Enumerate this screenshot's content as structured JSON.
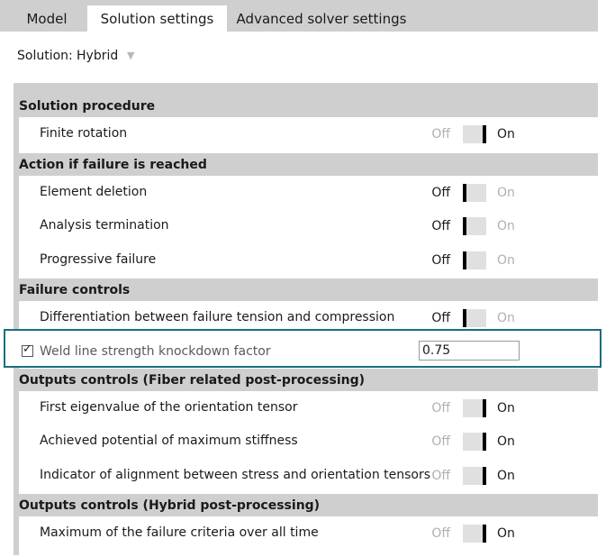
{
  "tabs": [
    {
      "label": "Model",
      "active": false
    },
    {
      "label": "Solution settings",
      "active": true
    },
    {
      "label": "Advanced solver settings",
      "active": false
    }
  ],
  "solution": {
    "label": "Solution:",
    "value": "Hybrid"
  },
  "toggle_text": {
    "off": "Off",
    "on": "On"
  },
  "sections": [
    {
      "title": "Solution procedure",
      "rows": [
        {
          "label": "Finite rotation",
          "state": "on"
        }
      ]
    },
    {
      "title": "Action if failure is reached",
      "rows": [
        {
          "label": "Element deletion",
          "state": "off"
        },
        {
          "label": "Analysis termination",
          "state": "off"
        },
        {
          "label": "Progressive failure",
          "state": "off"
        }
      ]
    },
    {
      "title": "Failure controls",
      "rows": [
        {
          "label": "Differentiation between failure tension and compression",
          "state": "off"
        }
      ]
    },
    {
      "title": "Outputs controls (Fiber related post-processing)",
      "rows": [
        {
          "label": "First eigenvalue of the orientation tensor",
          "state": "on"
        },
        {
          "label": "Achieved potential of maximum stiffness",
          "state": "on"
        },
        {
          "label": "Indicator of alignment between stress and orientation tensors",
          "state": "on"
        }
      ]
    },
    {
      "title": "Outputs controls (Hybrid post-processing)",
      "rows": [
        {
          "label": "Maximum of the failure criteria over all time",
          "state": "on"
        }
      ]
    }
  ],
  "weld": {
    "checked": true,
    "check_glyph": "✓",
    "label": "Weld line strength knockdown factor",
    "value": "0.75"
  },
  "colors": {
    "highlight_border": "#1a6e7a",
    "section_bg": "#cfcfcf",
    "toggle_track": "#e0e0e0",
    "toggle_knob": "#000000",
    "disabled_text": "#b0b0b0"
  }
}
